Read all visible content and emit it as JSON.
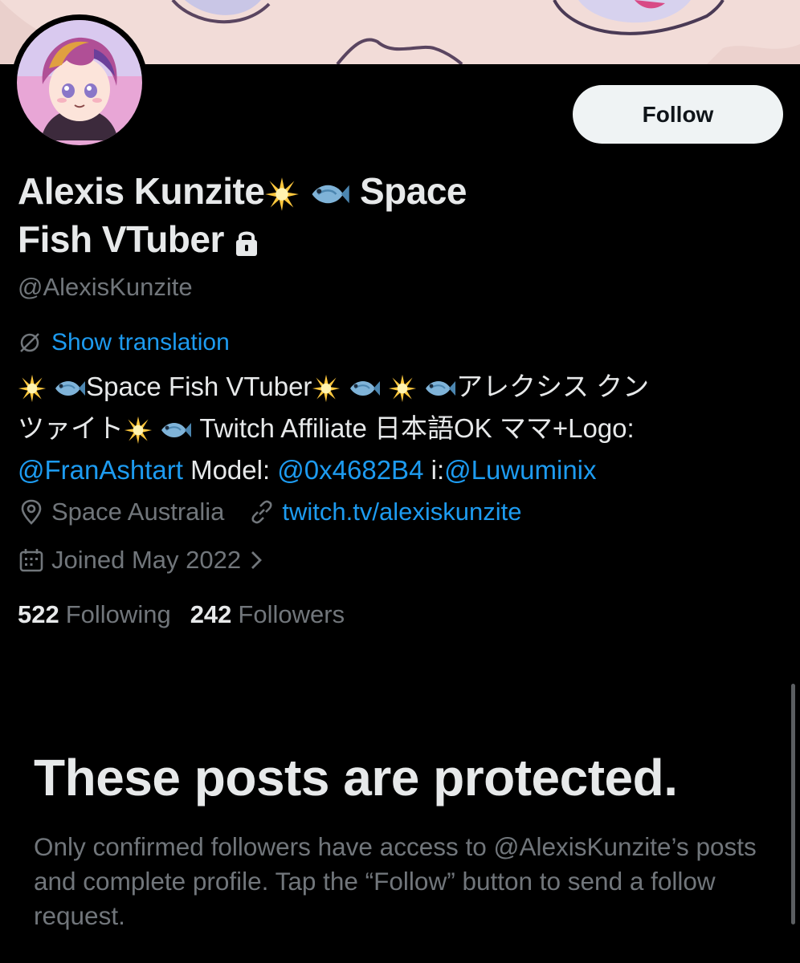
{
  "profile": {
    "follow_label": "Follow",
    "name_part1": "Alexis Kunzite",
    "name_part2": "Space",
    "name_part3": "Fish VTuber",
    "handle": "@AlexisKunzite",
    "show_translation": "Show translation",
    "bio": {
      "seg1": "Space Fish VTuber",
      "seg2": "アレクシス クン",
      "seg3": "ツァイト",
      "seg4": " Twitch Affiliate 日本語OK ママ+Logo:",
      "mention1": "@FranAshtart",
      "seg5": " Model: ",
      "mention2": "@0x4682B4",
      "seg6": " i:",
      "mention3": "@Luwuminix"
    },
    "location": "Space Australia",
    "website": "twitch.tv/alexiskunzite",
    "joined": "Joined May 2022",
    "following_count": "522",
    "following_label": "Following",
    "followers_count": "242",
    "followers_label": "Followers"
  },
  "protected": {
    "title": "These posts are protected.",
    "body": "Only confirmed followers have access to @AlexisKunzite’s posts and complete profile. Tap the “Follow” button to send a follow request."
  },
  "colors": {
    "background": "#000000",
    "text": "#e7e9ea",
    "muted": "#71767b",
    "link": "#1d9bf0",
    "button_bg": "#eff3f4"
  },
  "icons": [
    "sparkle-icon",
    "fish-icon",
    "lock-icon",
    "translate-icon",
    "location-pin-icon",
    "link-icon",
    "calendar-icon",
    "chevron-right-icon"
  ]
}
